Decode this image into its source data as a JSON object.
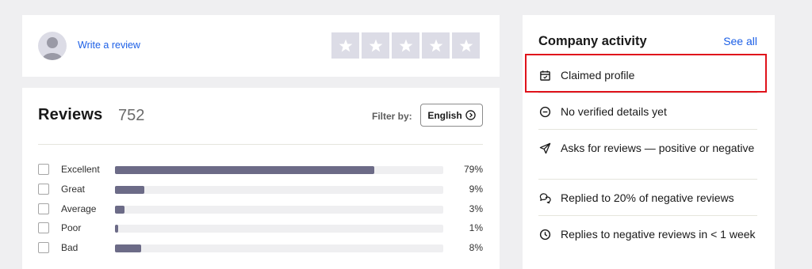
{
  "write_review": {
    "link_label": "Write a review",
    "stars": 5
  },
  "reviews": {
    "title": "Reviews",
    "count": "752",
    "filter_label": "Filter by:",
    "filter_value": "English",
    "distribution": [
      {
        "label": "Excellent",
        "percent_text": "79%",
        "percent": 79
      },
      {
        "label": "Great",
        "percent_text": "9%",
        "percent": 9
      },
      {
        "label": "Average",
        "percent_text": "3%",
        "percent": 3
      },
      {
        "label": "Poor",
        "percent_text": "1%",
        "percent": 1
      },
      {
        "label": "Bad",
        "percent_text": "8%",
        "percent": 8
      }
    ]
  },
  "activity": {
    "title": "Company activity",
    "see_all": "See all",
    "items": [
      {
        "icon": "calendar-icon",
        "text": "Claimed profile"
      },
      {
        "icon": "minus-circle-icon",
        "text": "No verified details yet"
      },
      {
        "icon": "paper-plane-icon",
        "text": "Asks for reviews — positive or negative"
      },
      {
        "icon": "chat-bubbles-icon",
        "text": "Replied to 20% of negative reviews"
      },
      {
        "icon": "clock-icon",
        "text": "Replies to negative reviews in < 1 week"
      }
    ]
  },
  "colors": {
    "highlight": "#e0121b",
    "link": "#1c5fe6",
    "bar_fill": "#6c6b87",
    "bar_track": "#efeff1",
    "star_empty": "#dcdce6"
  }
}
